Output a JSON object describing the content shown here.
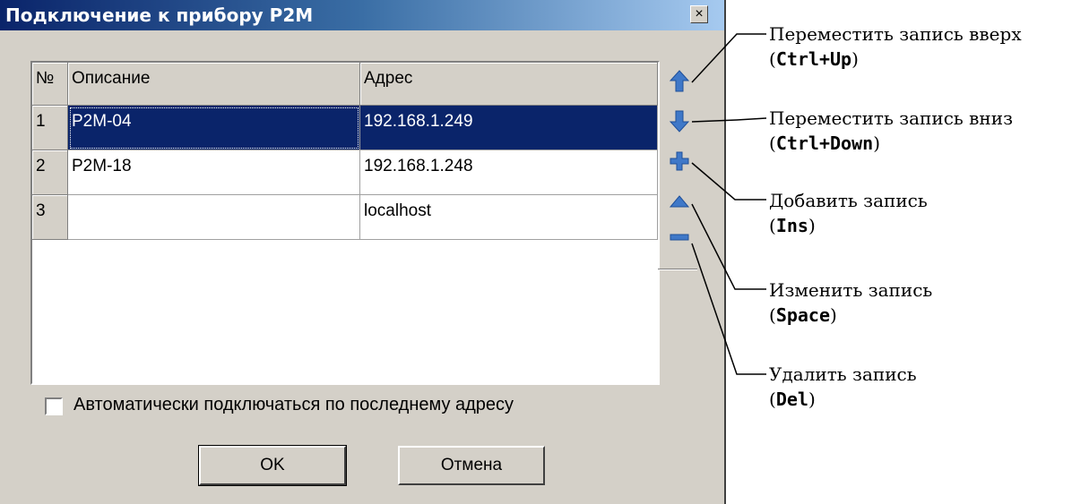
{
  "dialog": {
    "title": "Подключение к прибору P2M",
    "close_glyph": "×"
  },
  "table": {
    "headers": [
      "№",
      "Описание",
      "Адрес"
    ],
    "rows": [
      {
        "num": "1",
        "desc": "P2M-04",
        "addr": "192.168.1.249",
        "selected": true
      },
      {
        "num": "2",
        "desc": "P2M-18",
        "addr": "192.168.1.248",
        "selected": false
      },
      {
        "num": "3",
        "desc": "",
        "addr": "localhost",
        "selected": false
      }
    ]
  },
  "side_buttons": [
    {
      "icon": "arrow-up-icon",
      "color": "#3f78c8"
    },
    {
      "icon": "arrow-down-icon",
      "color": "#3f78c8"
    },
    {
      "icon": "plus-icon",
      "color": "#3f78c8"
    },
    {
      "icon": "triangle-up-icon",
      "color": "#3f78c8"
    },
    {
      "icon": "minus-icon",
      "color": "#3f78c8"
    }
  ],
  "checkbox": {
    "label": "Автоматически подключаться по последнему адресу",
    "checked": false
  },
  "buttons": {
    "ok": "OK",
    "cancel": "Отмена"
  },
  "annotations": [
    {
      "text": "Переместить запись вверх",
      "shortcut": "Ctrl+Up"
    },
    {
      "text": "Переместить запись вниз",
      "shortcut": "Ctrl+Down"
    },
    {
      "text": "Добавить запись",
      "shortcut": "Ins"
    },
    {
      "text": "Изменить запись",
      "shortcut": "Space"
    },
    {
      "text": "Удалить запись",
      "shortcut": "Del"
    }
  ],
  "colors": {
    "title_start": "#0a246a",
    "selection": "#0a246a",
    "face": "#d4d0c8",
    "icon_blue": "#3f78c8"
  }
}
